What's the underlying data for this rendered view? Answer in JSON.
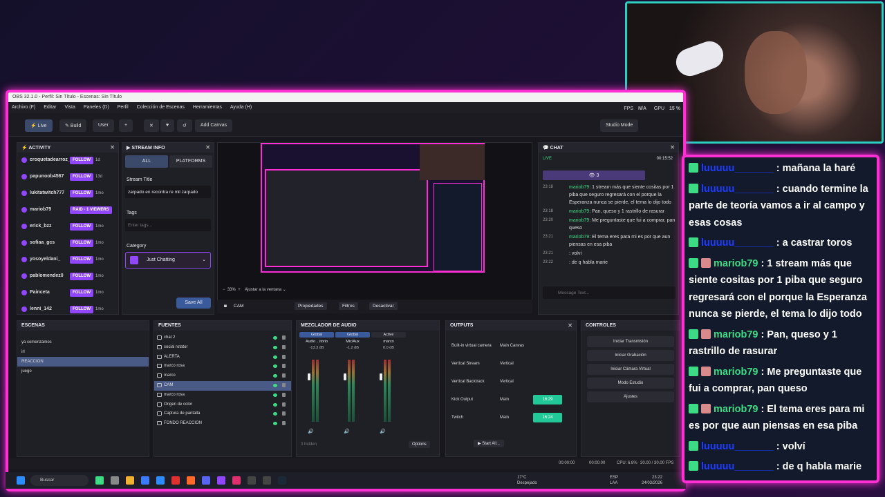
{
  "window_title": "OBS 32.1.0 - Perfil: Sin Título - Escenas: Sin Título",
  "menu": [
    "Archivo (F)",
    "Editar",
    "Vista",
    "Paneles (D)",
    "Perfil",
    "Colección de Escenas",
    "Herramientas",
    "Ayuda (H)"
  ],
  "perf": {
    "fps_label": "FPS",
    "fps": "N/A",
    "gpu_label": "GPU",
    "gpu": "15 %"
  },
  "toolbar": {
    "live": "Live",
    "build": "Build",
    "user": "User",
    "add_canvas": "Add Canvas",
    "studio_mode": "Studio Mode"
  },
  "activity": {
    "title": "ACTIVITY",
    "items": [
      {
        "user": "croquetadearroz_",
        "badge": "FOLLOW",
        "time": "1d"
      },
      {
        "user": "papunoob4567",
        "badge": "FOLLOW",
        "time": "13d"
      },
      {
        "user": "lukitatwitch777",
        "badge": "FOLLOW",
        "time": "1mo"
      },
      {
        "user": "mariob79",
        "badge": "RAID - 1 VIEWERS",
        "time": "1mo"
      },
      {
        "user": "erick_bzz",
        "badge": "FOLLOW",
        "time": "1mo"
      },
      {
        "user": "sofiaa_gcs",
        "badge": "FOLLOW",
        "time": "1mo"
      },
      {
        "user": "yosoyeldani_",
        "badge": "FOLLOW",
        "time": "1mo"
      },
      {
        "user": "pablomendez0",
        "badge": "FOLLOW",
        "time": "1mo"
      },
      {
        "user": "Painceta",
        "badge": "FOLLOW",
        "time": "1mo"
      },
      {
        "user": "lenni_142",
        "badge": "FOLLOW",
        "time": "1mo"
      }
    ]
  },
  "stream_info": {
    "title": "STREAM INFO",
    "tab_all": "ALL",
    "tab_platforms": "PLATFORMS",
    "stream_title_label": "Stream Title",
    "stream_title_value": "zarpado en recontra re mil zarpado",
    "tags_label": "Tags",
    "tags_placeholder": "Enter tags...",
    "category_label": "Category",
    "category_value": "Just Chatting",
    "save": "Save All"
  },
  "preview": {
    "zoom": "33%",
    "fit": "Ajustar a la ventana"
  },
  "source_bar": {
    "source": "CAM",
    "properties": "Propiedades",
    "filters": "Filtros",
    "deactivate": "Desactivar"
  },
  "chat": {
    "title": "CHAT",
    "live": "LIVE",
    "timer": "00:15:52",
    "viewers": "3",
    "input_placeholder": "Message Text...",
    "lines": [
      {
        "time": "23:18",
        "user": "mariob79",
        "text": "1 stream más que siente cositas por 1 piba que seguro regresará con el porque la Esperanza nunca se pierde, el tema lo dijo todo"
      },
      {
        "time": "23:18",
        "user": "mariob79",
        "text": "Pan, queso y 1 rastrillo de rasurar"
      },
      {
        "time": "23:20",
        "user": "mariob79",
        "text": "Me preguntaste que fui a comprar, pan queso"
      },
      {
        "time": "23:21",
        "user": "mariob79",
        "text": "El tema eres para mi es por que aun piensas en esa piba"
      },
      {
        "time": "23:21",
        "user": "",
        "text": "volví"
      },
      {
        "time": "23:22",
        "user": "",
        "text": "de q habla marie"
      }
    ]
  },
  "scenes": {
    "title": "ESCENAS",
    "items": [
      "ya comenzamos",
      "irl",
      "REACCION",
      "juego"
    ],
    "selected": 2
  },
  "sources": {
    "title": "FUENTES",
    "items": [
      "chat 2",
      "social rotator",
      "ALERTA",
      "marco rosa",
      "marco",
      "CAM",
      "marco rosa",
      "Origen de color",
      "Captura de pantalla",
      "FONDO REACCION"
    ],
    "selected": 5
  },
  "mixer": {
    "title": "MEZCLADOR DE AUDIO",
    "channels": [
      {
        "tag": "Global",
        "name": "Audio ...itorio",
        "db": "-13.3 dB"
      },
      {
        "tag": "Global",
        "name": "Mic/Aux",
        "db": "-1.2 dB"
      },
      {
        "tag": "Active",
        "name": "marco",
        "db": "0.0 dB"
      }
    ],
    "hidden": "0 hidden",
    "options": "Options"
  },
  "outputs": {
    "title": "OUTPUTS",
    "rows": [
      {
        "name": "Built-in virtual camera",
        "canvas": "Main Canvas",
        "status": ""
      },
      {
        "name": "Vertical Stream",
        "canvas": "Vertical",
        "status": ""
      },
      {
        "name": "Vertical Backtrack",
        "canvas": "Vertical",
        "status": ""
      },
      {
        "name": "Kick Output",
        "canvas": "Main",
        "status": "16:29"
      },
      {
        "name": "Twitch",
        "canvas": "Main",
        "status": "16:24"
      }
    ],
    "start_all": "Start All..."
  },
  "controls": {
    "title": "CONTROLES",
    "buttons": [
      "Iniciar Transmisión",
      "Iniciar Grabación",
      "Iniciar Cámara Virtual",
      "Modo Estudio",
      "Ajustes"
    ]
  },
  "statusbar": {
    "rec": "00:00:00",
    "stream": "00:00:00",
    "cpu": "CPU: 6.8%",
    "fps": "30.00 / 30.00 FPS"
  },
  "taskbar": {
    "search": "Buscar",
    "weather": "17°C",
    "weather_desc": "Despejado",
    "lang1": "ESP",
    "lang2": "LAA",
    "time": "23:22",
    "date": "24/03/2026"
  },
  "overlay_chat": [
    {
      "user": "luuuuu_______",
      "blue": true,
      "emote": false,
      "text": ": mañana la haré"
    },
    {
      "user": "luuuuu_______",
      "blue": true,
      "emote": false,
      "text": ": cuando termine la parte de teoría vamos a ir al campo y esas cosas"
    },
    {
      "user": "luuuuu_______",
      "blue": true,
      "emote": false,
      "text": ": a castrar toros"
    },
    {
      "user": "mariob79",
      "blue": false,
      "emote": true,
      "text": ": 1 stream más que siente cositas por 1 piba que seguro regresará con el porque la Esperanza nunca se pierde, el tema lo dijo todo"
    },
    {
      "user": "mariob79",
      "blue": false,
      "emote": true,
      "text": ": Pan, queso y 1 rastrillo de rasurar"
    },
    {
      "user": "mariob79",
      "blue": false,
      "emote": true,
      "text": ": Me preguntaste que fui a comprar, pan queso"
    },
    {
      "user": "mariob79",
      "blue": false,
      "emote": true,
      "text": ": El tema eres para mi es por que aun piensas en esa piba"
    },
    {
      "user": "luuuuu_______",
      "blue": true,
      "emote": false,
      "text": ": volví"
    },
    {
      "user": "luuuuu_______",
      "blue": true,
      "emote": false,
      "text": ": de q habla marie"
    }
  ],
  "colors": {
    "accent": "#ff2fd4",
    "twitch": "#9146ff",
    "kick": "#3ddc84",
    "webcam_border": "#2ad0c0"
  }
}
